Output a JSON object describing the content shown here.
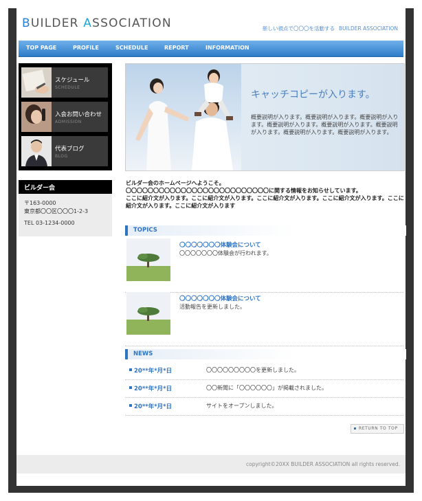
{
  "header": {
    "logo": {
      "first_initial": "B",
      "first_rest": "UILDER ",
      "second_initial": "A",
      "second_rest": "SSOCIATION"
    },
    "tagline": "新しい視点で〇〇〇を活動する",
    "tagline_org": "BUILDER ASSOCIATION"
  },
  "nav": {
    "items": [
      {
        "label": "TOP PAGE"
      },
      {
        "label": "PROFILE"
      },
      {
        "label": "SCHEDULE"
      },
      {
        "label": "REPORT"
      },
      {
        "label": "INFORMATION"
      }
    ]
  },
  "side_menu": {
    "items": [
      {
        "label": "スケジュール",
        "sub": "SCHEDULE"
      },
      {
        "label": "入会お問い合わせ",
        "sub": "ADMISSION"
      },
      {
        "label": "代表ブログ",
        "sub": "BLOG"
      }
    ]
  },
  "side_info": {
    "title": "ビルダー会",
    "postal": "〒163-0000",
    "address": "東京都〇〇区〇〇〇1-2-3",
    "tel": "TEL 03-1234-0000"
  },
  "hero": {
    "catch": "キャッチコピーが入ります。",
    "description": "概要説明が入ります。概要説明が入ります。概要説明が入ります。概要説明が入ります。概要説明が入ります。概要説明が入ります。概要説明が入ります。概要説明が入ります。"
  },
  "intro": {
    "line1": "ビルダー会のホームページへようこそ。",
    "line2": "〇〇〇〇〇〇〇〇〇〇〇〇〇〇〇〇〇〇〇〇〇〇〇〇〇〇に関する情報をお知らせしています。",
    "line3": "ここに紹介文が入ります。ここに紹介文が入ります。ここに紹介文が入ります。ここに紹介文が入ります。ここに紹介文が入ります。ここに紹介文が入ります"
  },
  "topics": {
    "heading": "TOPICS",
    "items": [
      {
        "prefix": "〇〇〇〇〇〇〇",
        "title": "体験会について",
        "desc": "〇〇〇〇〇〇〇体験会が行われます。"
      },
      {
        "prefix": "〇〇〇〇〇〇〇",
        "title": "体験会について",
        "desc": "活動報告を更新しました。"
      }
    ]
  },
  "news": {
    "heading": "NEWS",
    "items": [
      {
        "date": "20**年*月*日",
        "text": "〇〇〇〇〇〇〇〇〇を更新しました。"
      },
      {
        "date": "20**年*月*日",
        "text": "〇〇新聞に「〇〇〇〇〇〇」が掲載されました。"
      },
      {
        "date": "20**年*月*日",
        "text": "サイトをオープンしました。"
      }
    ]
  },
  "return_top": "RETURN TO TOP",
  "footer": {
    "copyright": "copyright©20XX BUILDER ASSOCIATION all rights reserved."
  },
  "colors": {
    "accent": "#2e74c4",
    "nav_top": "#6fb0ea",
    "nav_bottom": "#2e7cc9",
    "frame": "#333333"
  }
}
